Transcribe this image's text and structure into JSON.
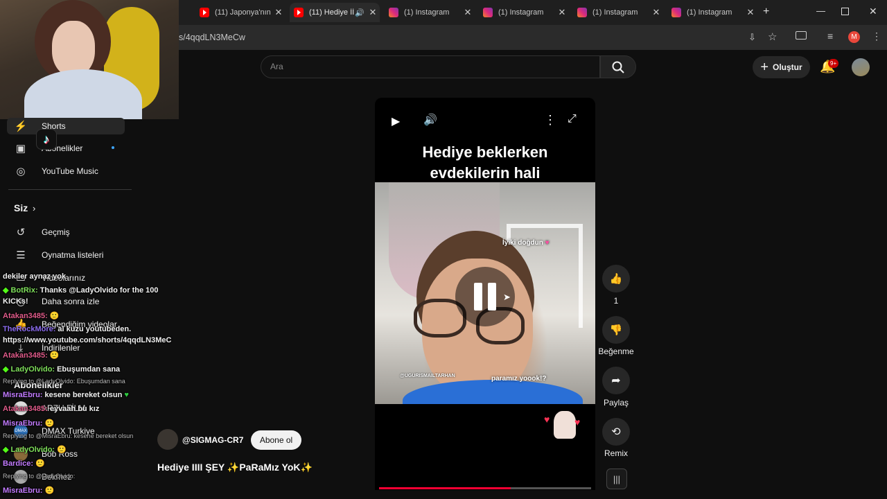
{
  "browser": {
    "tabs": [
      {
        "title": "(11) Japonya'nın",
        "icon": "youtube-icon",
        "active": false
      },
      {
        "title": "(11) Hediye İİ",
        "icon": "youtube-icon",
        "active": true
      },
      {
        "title": "(1) Instagram",
        "icon": "instagram-icon",
        "active": false
      },
      {
        "title": "(1) Instagram",
        "icon": "instagram-icon",
        "active": false
      },
      {
        "title": "(1) Instagram",
        "icon": "instagram-icon",
        "active": false
      },
      {
        "title": "(1) Instagram",
        "icon": "instagram-icon",
        "active": false
      }
    ],
    "url": "s/4qqdLN3MeCw",
    "profile_initial": "M",
    "accent": "#e9473b"
  },
  "header": {
    "search_placeholder": "Ara",
    "create_label": "Oluştur",
    "notifications_badge": "9+"
  },
  "sidebar": {
    "shorts": "Shorts",
    "subscriptions": "Abonelikler",
    "music": "YouTube Music",
    "you": "Siz",
    "history": "Geçmiş",
    "playlists": "Oynatma listeleri",
    "videos": "Videolarınız",
    "watch_later": "Daha sonra izle",
    "liked": "Beğendiğim videolar",
    "downloads": "İndirilenler",
    "subs_header": "Abonelikler",
    "channels": [
      "ARZU FİLM",
      "DMAX Turkiye",
      "Bob Ross",
      "Bekmez"
    ]
  },
  "chat": [
    {
      "user": "",
      "text": "dekiler aynaz yok",
      "color": "#ffffff"
    },
    {
      "user": "BotRix:",
      "text": "Thanks @LadyOlvido for the 100",
      "color": "#7fe05b"
    },
    {
      "user": "",
      "text": "KICKs!",
      "color": "#ffffff"
    },
    {
      "user": "Atakan3485:",
      "text": "",
      "color": "#e05b8a"
    },
    {
      "user": "TheRockMore:",
      "text": "al kuzu youtubeden.",
      "color": "#8c6cf0"
    },
    {
      "user": "",
      "text": "https://www.youtube.com/shorts/4qqdLN3MeC",
      "color": "#ffffff"
    },
    {
      "user": "Atakan3485:",
      "text": "",
      "color": "#e05b8a"
    },
    {
      "user": "LadyOlvido:",
      "text": "Ebuşumdan sana",
      "color": "#7fe05b"
    },
    {
      "user": "",
      "text": "Replying to @LadyOlvido: Ebuşumdan sana",
      "color": "#bbbbbb"
    },
    {
      "user": "MisraEbru:",
      "text": "kesene bereket olsun",
      "color": "#c27bff"
    },
    {
      "user": "Atakan3485:",
      "text": "eyvaah bu kız",
      "color": "#e05b8a"
    },
    {
      "user": "MisraEbru:",
      "text": "",
      "color": "#c27bff"
    },
    {
      "user": "",
      "text": "Replying to @MisraEbru: kesene bereket olsun",
      "color": "#bbbbbb"
    },
    {
      "user": "LadyOlvido:",
      "text": "",
      "color": "#7fe05b"
    },
    {
      "user": "Bardice:",
      "text": "",
      "color": "#c27bff"
    },
    {
      "user": "",
      "text": "Replying to @LadyOlvido:",
      "color": "#bbbbbb"
    },
    {
      "user": "MisraEbru:",
      "text": "",
      "color": "#c27bff"
    }
  ],
  "player": {
    "caption_line1": "Hediye beklerken",
    "caption_line2": "evdekilerin hali",
    "sticker1": "İyiki doğdun",
    "sticker2": "paramız yoook!?",
    "watermark": "@UGURISMAILTARHAN",
    "progress": 0.62,
    "state": "paused"
  },
  "channel": {
    "handle": "@SIGMAG-CR7",
    "subscribe_label": "Abone ol",
    "title": "Hediye IIII ŞEY ✨PaRaMız YoK✨"
  },
  "actions": {
    "likes": "1",
    "dislike_label": "Beğenme",
    "share_label": "Paylaş",
    "remix_label": "Remix"
  }
}
